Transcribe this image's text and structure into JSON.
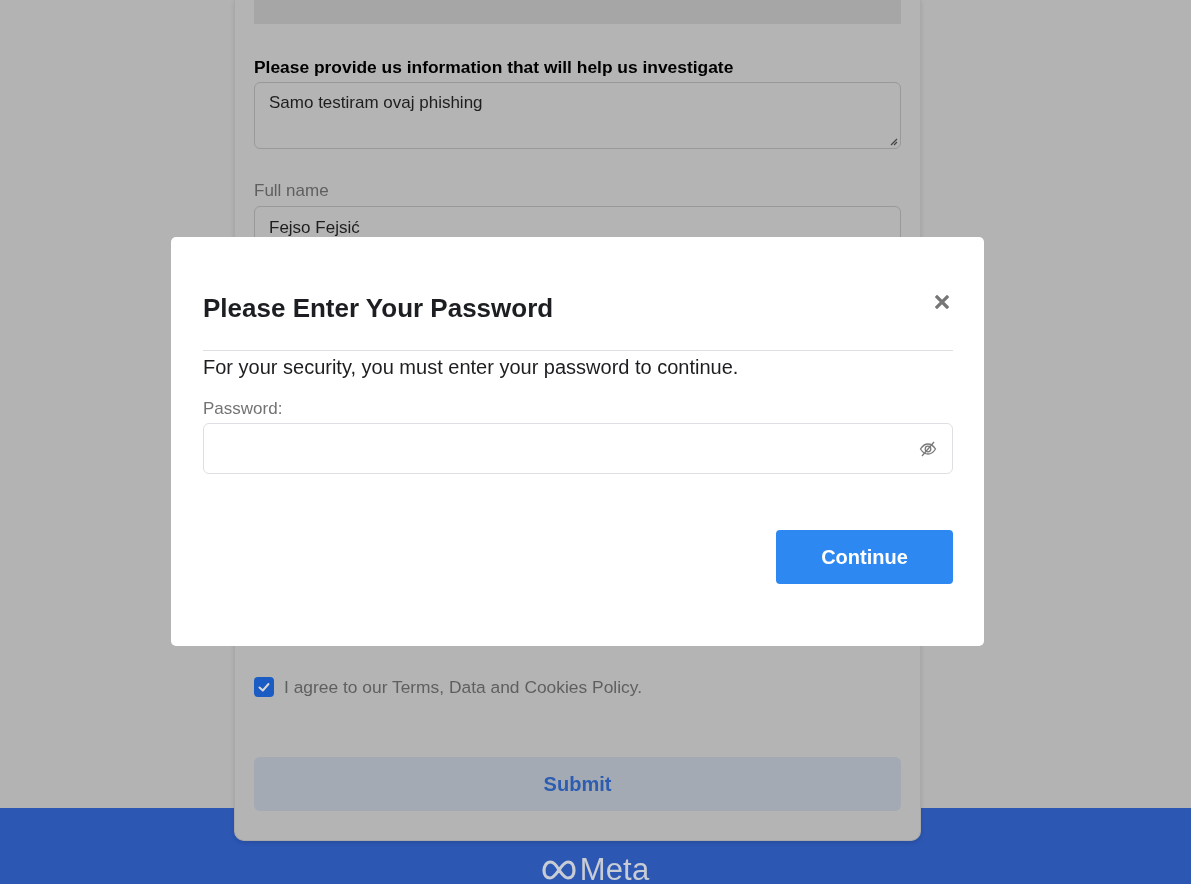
{
  "report_form": {
    "investigate_label": "Please provide us information that will help us investigate",
    "details_field": {
      "value": "Samo testiram ovaj phishing"
    },
    "full_name": {
      "label": "Full name",
      "value": "Fejso Fejsić"
    },
    "terms": {
      "label": "I agree to our Terms, Data and Cookies Policy.",
      "checked": true
    },
    "submit_button": "Submit"
  },
  "footer": {
    "logo_text": "Meta"
  },
  "dialog": {
    "title": "Please Enter Your Password",
    "message": "For your security, you must enter your password to continue.",
    "password": {
      "label": "Password:"
    },
    "continue_button": "Continue"
  }
}
